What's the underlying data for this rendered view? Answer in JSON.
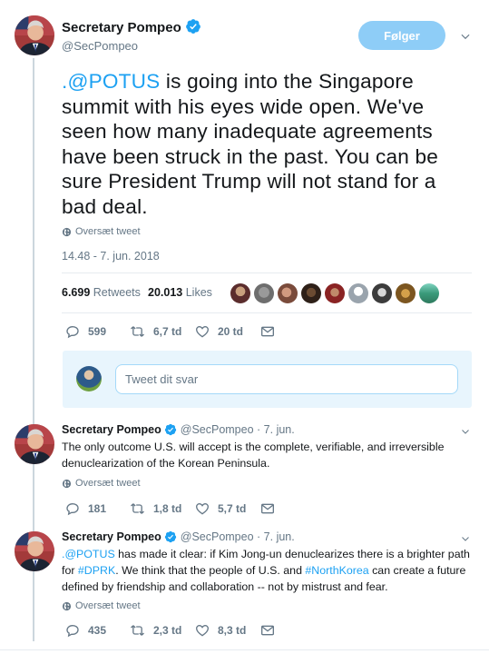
{
  "main_tweet": {
    "display_name": "Secretary Pompeo",
    "handle": "@SecPompeo",
    "follow_label": "Følger",
    "text_mention": ".@POTUS",
    "text_body": " is going into the Singapore summit with his eyes wide open. We've seen how many inadequate agreements have been struck in the past. You can be sure President Trump will not stand for a bad deal.",
    "translate_label": "Oversæt tweet",
    "timestamp": "14.48 - 7. jun. 2018",
    "retweets_count": "6.699",
    "retweets_label": "Retweets",
    "likes_count": "20.013",
    "likes_label": "Likes",
    "replies": "599",
    "retweets_short": "6,7 td",
    "likes_short": "20 td"
  },
  "reply_box": {
    "placeholder": "Tweet dit svar"
  },
  "thread": [
    {
      "display_name": "Secretary Pompeo",
      "handle": "@SecPompeo",
      "date": "· 7. jun.",
      "text": "The only outcome U.S. will accept is the complete, verifiable, and irreversible denuclearization of the Korean Peninsula.",
      "translate_label": "Oversæt tweet",
      "replies": "181",
      "retweets": "1,8 td",
      "likes": "5,7 td"
    },
    {
      "display_name": "Secretary Pompeo",
      "handle": "@SecPompeo",
      "date": "· 7. jun.",
      "text_parts": [
        ".@POTUS",
        " has made it clear: if Kim Jong-un denuclearizes there is a brighter path for ",
        "#DPRK",
        ". We think that the people of U.S. and ",
        "#NorthKorea",
        " can create a future defined by friendship and collaboration -- not by mistrust and fear."
      ],
      "translate_label": "Oversæt tweet",
      "replies": "435",
      "retweets": "2,3 td",
      "likes": "8,3 td"
    }
  ],
  "colors": {
    "accent": "#1da1f2",
    "follow_button": "#8ecdf7",
    "muted": "#657786",
    "divider": "#e6ecf0",
    "thread_line": "#ccd6dd"
  }
}
